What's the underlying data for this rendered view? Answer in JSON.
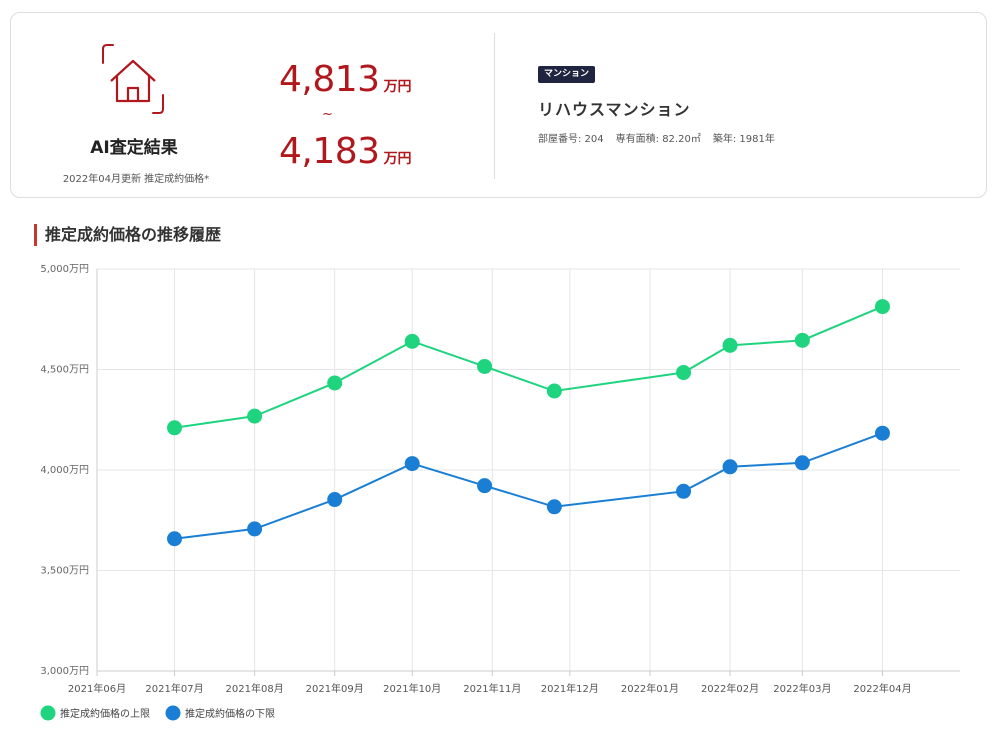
{
  "summary": {
    "ai_title": "AI査定結果",
    "ai_subtitle": "2022年04月更新 推定成約価格*",
    "price_upper": "4,813",
    "price_lower": "4,183",
    "price_unit": "万円",
    "range_symbol": "~"
  },
  "property": {
    "badge": "マンション",
    "name": "リハウスマンション",
    "room_number": "部屋番号: 204",
    "floor_area": "専有面積: 82.20㎡",
    "built_year": "築年: 1981年"
  },
  "section_title": "推定成約価格の推移履歴",
  "colors": {
    "accent_red": "#b0181e",
    "upper_series": "#1fd47f",
    "lower_series": "#1a7fd4",
    "badge_bg": "#1f2540"
  },
  "icons": {
    "house": "house-icon"
  },
  "chart_data": {
    "type": "line",
    "title": "",
    "xlabel": "",
    "ylabel": "",
    "x_axis_range": [
      "2021-06-01",
      "2022-05-01"
    ],
    "x_ticks": [
      "2021年06月",
      "2021年07月",
      "2021年08月",
      "2021年09月",
      "2021年10月",
      "2021年11月",
      "2021年12月",
      "2022年01月",
      "2022年02月",
      "2022年03月",
      "2022年04月"
    ],
    "y_ticks": [
      "3,000万円",
      "3,500万円",
      "4,000万円",
      "4,500万円",
      "5,000万円"
    ],
    "y_unit": "万円",
    "ylim": [
      3000,
      5000
    ],
    "grid": true,
    "legend_position": "bottom-left",
    "x": [
      "2021-07-01",
      "2021-08-01",
      "2021-09-01",
      "2021-10-01",
      "2021-10-29",
      "2021-11-25",
      "2022-01-14",
      "2022-02-01",
      "2022-03-01",
      "2022-04-01"
    ],
    "series": [
      {
        "name": "推定成約価格の上限",
        "color": "#1fd47f",
        "values": [
          4210,
          4268,
          4433,
          4640,
          4515,
          4393,
          4485,
          4620,
          4645,
          4813
        ]
      },
      {
        "name": "推定成約価格の下限",
        "color": "#1a7fd4",
        "values": [
          3658,
          3707,
          3853,
          4032,
          3922,
          3817,
          3894,
          4016,
          4036,
          4183
        ]
      }
    ]
  }
}
